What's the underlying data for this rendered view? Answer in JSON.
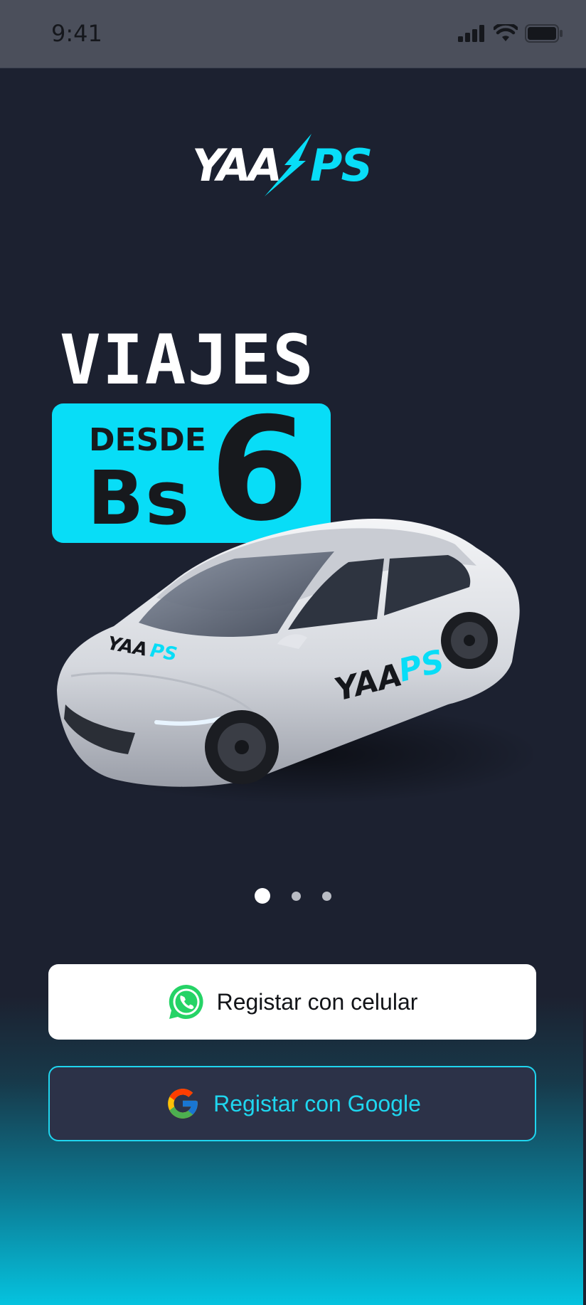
{
  "status_bar": {
    "time": "9:41",
    "icons": [
      "signal-icon",
      "wifi-icon",
      "battery-icon"
    ]
  },
  "logo": {
    "text_left": "YAA",
    "text_right": "PS",
    "colors": {
      "left": "#ffffff",
      "right": "#08ddf7"
    }
  },
  "promo": {
    "headline": "VIAJES",
    "desde": "DESDE",
    "currency": "Bs",
    "amount": "6",
    "box_color": "#08ddf7"
  },
  "car": {
    "decal_left": "YAA",
    "decal_right": "PS"
  },
  "pager": {
    "count": 3,
    "active_index": 0
  },
  "buttons": {
    "phone_label": "Registar con celular",
    "phone_icon": "whatsapp-icon",
    "google_label": "Registar con Google",
    "google_icon": "google-icon"
  },
  "colors": {
    "accent": "#08ddf7",
    "background": "#1c2130",
    "whatsapp": "#25d366"
  }
}
